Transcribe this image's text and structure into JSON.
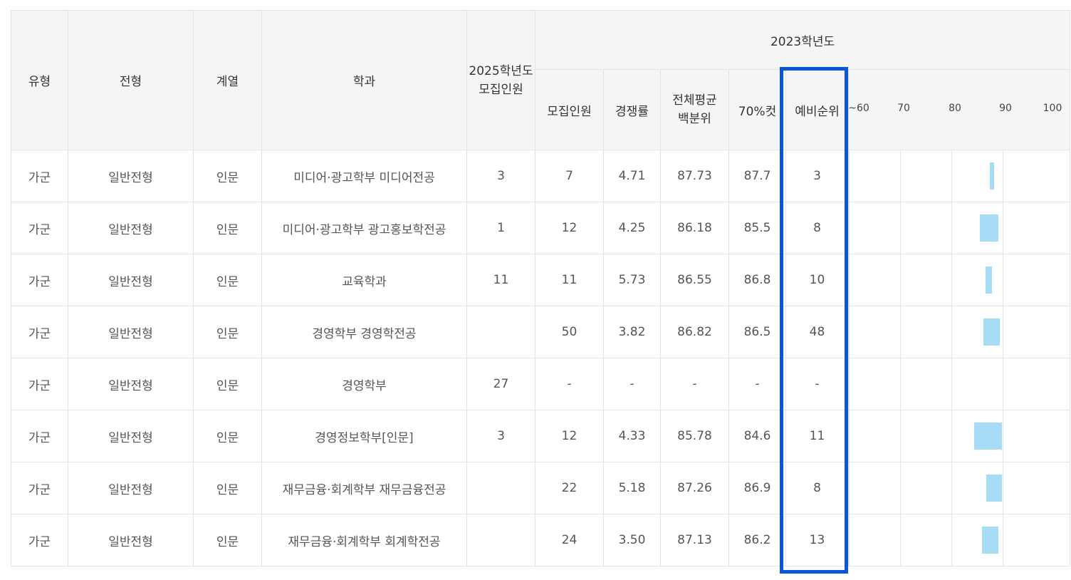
{
  "headers": {
    "type": "유형",
    "admission": "전형",
    "track": "계열",
    "dept": "학과",
    "quota2025_line1": "2025학년도",
    "quota2025_line2": "모집인원",
    "year2023": "2023학년도",
    "quota": "모집인원",
    "ratio": "경쟁률",
    "avg_line1": "전체평균",
    "avg_line2": "백분위",
    "cut70": "70%컷",
    "waitlist": "예비순위",
    "scale": [
      "~60",
      "70",
      "80",
      "90",
      "100"
    ]
  },
  "colors": {
    "highlight": "#0a56d8",
    "bar": "#a7dcf7"
  },
  "rows": [
    {
      "type": "가군",
      "admission": "일반전형",
      "track": "인문",
      "dept": "미디어·광고학부 미디어전공",
      "quota2025": "3",
      "quota": "7",
      "ratio": "4.71",
      "avg": "87.73",
      "cut70": "87.7",
      "waitlist": "3",
      "range": [
        87.5,
        88.3
      ]
    },
    {
      "type": "가군",
      "admission": "일반전형",
      "track": "인문",
      "dept": "미디어·광고학부 광고홍보학전공",
      "quota2025": "1",
      "quota": "12",
      "ratio": "4.25",
      "avg": "86.18",
      "cut70": "85.5",
      "waitlist": "8",
      "range": [
        85.5,
        89.2
      ]
    },
    {
      "type": "가군",
      "admission": "일반전형",
      "track": "인문",
      "dept": "교육학과",
      "quota2025": "11",
      "quota": "11",
      "ratio": "5.73",
      "avg": "86.55",
      "cut70": "86.8",
      "waitlist": "10",
      "range": [
        86.6,
        87.9
      ]
    },
    {
      "type": "가군",
      "admission": "일반전형",
      "track": "인문",
      "dept": "경영학부 경영학전공",
      "quota2025": "",
      "quota": "50",
      "ratio": "3.82",
      "avg": "86.82",
      "cut70": "86.5",
      "waitlist": "48",
      "range": [
        86.3,
        89.5
      ]
    },
    {
      "type": "가군",
      "admission": "일반전형",
      "track": "인문",
      "dept": "경영학부",
      "quota2025": "27",
      "quota": "-",
      "ratio": "-",
      "avg": "-",
      "cut70": "-",
      "waitlist": "-",
      "range": null
    },
    {
      "type": "가군",
      "admission": "일반전형",
      "track": "인문",
      "dept": "경영정보학부[인문]",
      "quota2025": "3",
      "quota": "12",
      "ratio": "4.33",
      "avg": "85.78",
      "cut70": "84.6",
      "waitlist": "11",
      "range": [
        84.5,
        89.8
      ]
    },
    {
      "type": "가군",
      "admission": "일반전형",
      "track": "인문",
      "dept": "재무금융·회계학부 재무금융전공",
      "quota2025": "",
      "quota": "22",
      "ratio": "5.18",
      "avg": "87.26",
      "cut70": "86.9",
      "waitlist": "8",
      "range": [
        86.8,
        89.8
      ]
    },
    {
      "type": "가군",
      "admission": "일반전형",
      "track": "인문",
      "dept": "재무금융·회계학부 회계학전공",
      "quota2025": "",
      "quota": "24",
      "ratio": "3.50",
      "avg": "87.13",
      "cut70": "86.2",
      "waitlist": "13",
      "range": [
        86.0,
        89.2
      ]
    }
  ]
}
